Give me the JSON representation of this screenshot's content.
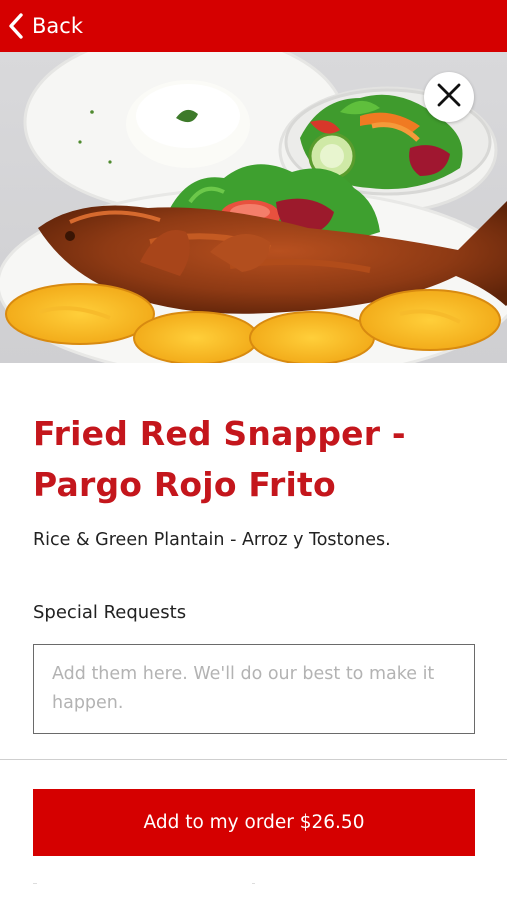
{
  "header": {
    "back_label": "Back",
    "back_icon": "chevron-left-icon",
    "bg_color": "#d50000"
  },
  "hero": {
    "image": "fried-red-snapper-dish",
    "close_icon": "close-icon"
  },
  "item": {
    "title_line1": "Fried Red Snapper -",
    "title_line2": "Pargo Rojo Frito",
    "description": "Rice & Green Plantain - Arroz y Tostones.",
    "title_color": "#c4161c"
  },
  "special_requests": {
    "label": "Special Requests",
    "placeholder": "Add them here. We'll do our best to make it happen.",
    "value": ""
  },
  "footer": {
    "add_button_label": "Add to my order $26.50",
    "button_color": "#d50000"
  }
}
